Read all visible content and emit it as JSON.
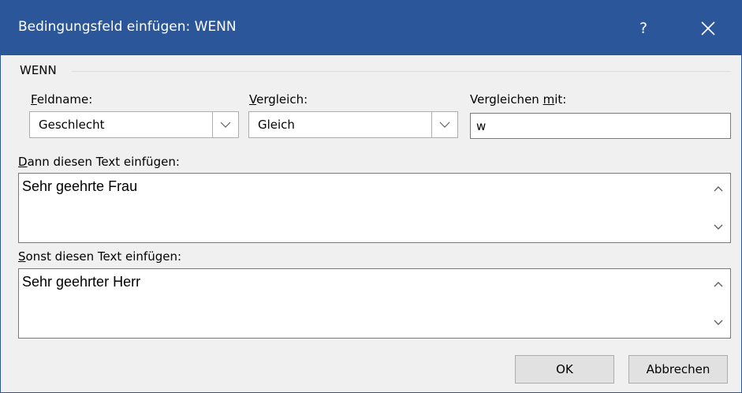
{
  "window": {
    "title": "Bedingungsfeld einfügen: WENN",
    "help_label": "?"
  },
  "group": {
    "label": "WENN"
  },
  "fields": {
    "feldname": {
      "label_accel": "F",
      "label_rest": "eldname:",
      "value": "Geschlecht"
    },
    "vergleich": {
      "label_accel": "V",
      "label_rest": "ergleich:",
      "value": "Gleich"
    },
    "vergleichen_mit": {
      "label_pre": "Vergleichen ",
      "label_accel": "m",
      "label_rest": "it:",
      "value": "w"
    }
  },
  "dann": {
    "label_accel": "D",
    "label_rest": "ann diesen Text einfügen:",
    "value": "Sehr geehrte Frau"
  },
  "sonst": {
    "label_accel": "S",
    "label_rest": "onst diesen Text einfügen:",
    "value": "Sehr geehrter Herr"
  },
  "buttons": {
    "ok": "OK",
    "cancel": "Abbrechen"
  },
  "colors": {
    "titlebar": "#2b579a",
    "dialog_bg": "#f0f0f0",
    "button_bg": "#e1e1e1"
  },
  "icons": {
    "close": "close-icon",
    "dropdown": "chevron-down-icon",
    "scroll_up": "chevron-up-icon",
    "scroll_down": "chevron-down-icon"
  }
}
